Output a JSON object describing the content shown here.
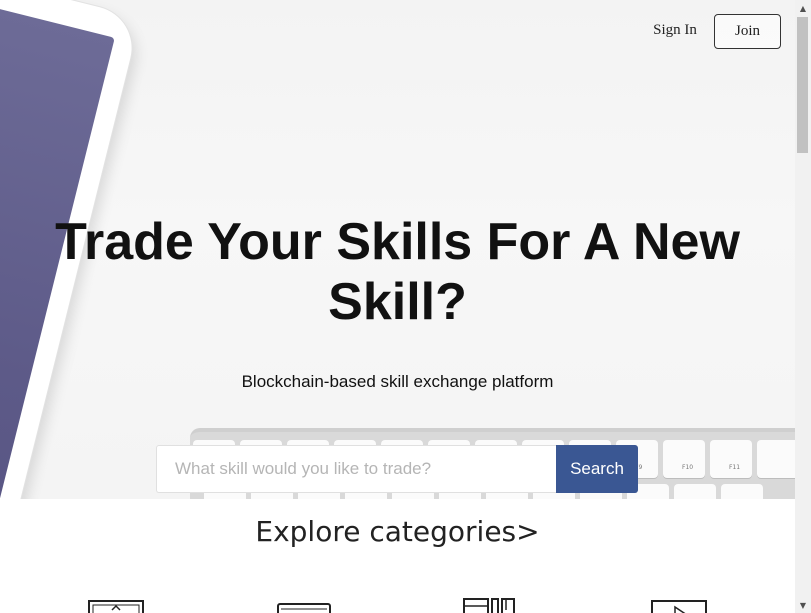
{
  "nav": {
    "signin_label": "Sign In",
    "join_label": "Join"
  },
  "hero": {
    "headline": "Trade Your Skills For A New Skill?",
    "subtitle": "Blockchain-based skill exchange platform",
    "search": {
      "placeholder": "What skill would you like to trade?",
      "value": "",
      "button_label": "Search"
    },
    "keyboard_keys": [
      "F9",
      "F10",
      "F11"
    ]
  },
  "categories": {
    "title": "Explore categories>",
    "icons": [
      "monitor-icon",
      "laptop-icon",
      "books-icon",
      "video-player-icon"
    ]
  },
  "colors": {
    "accent": "#3a5793",
    "tablet_screen": "#5d5a88"
  }
}
